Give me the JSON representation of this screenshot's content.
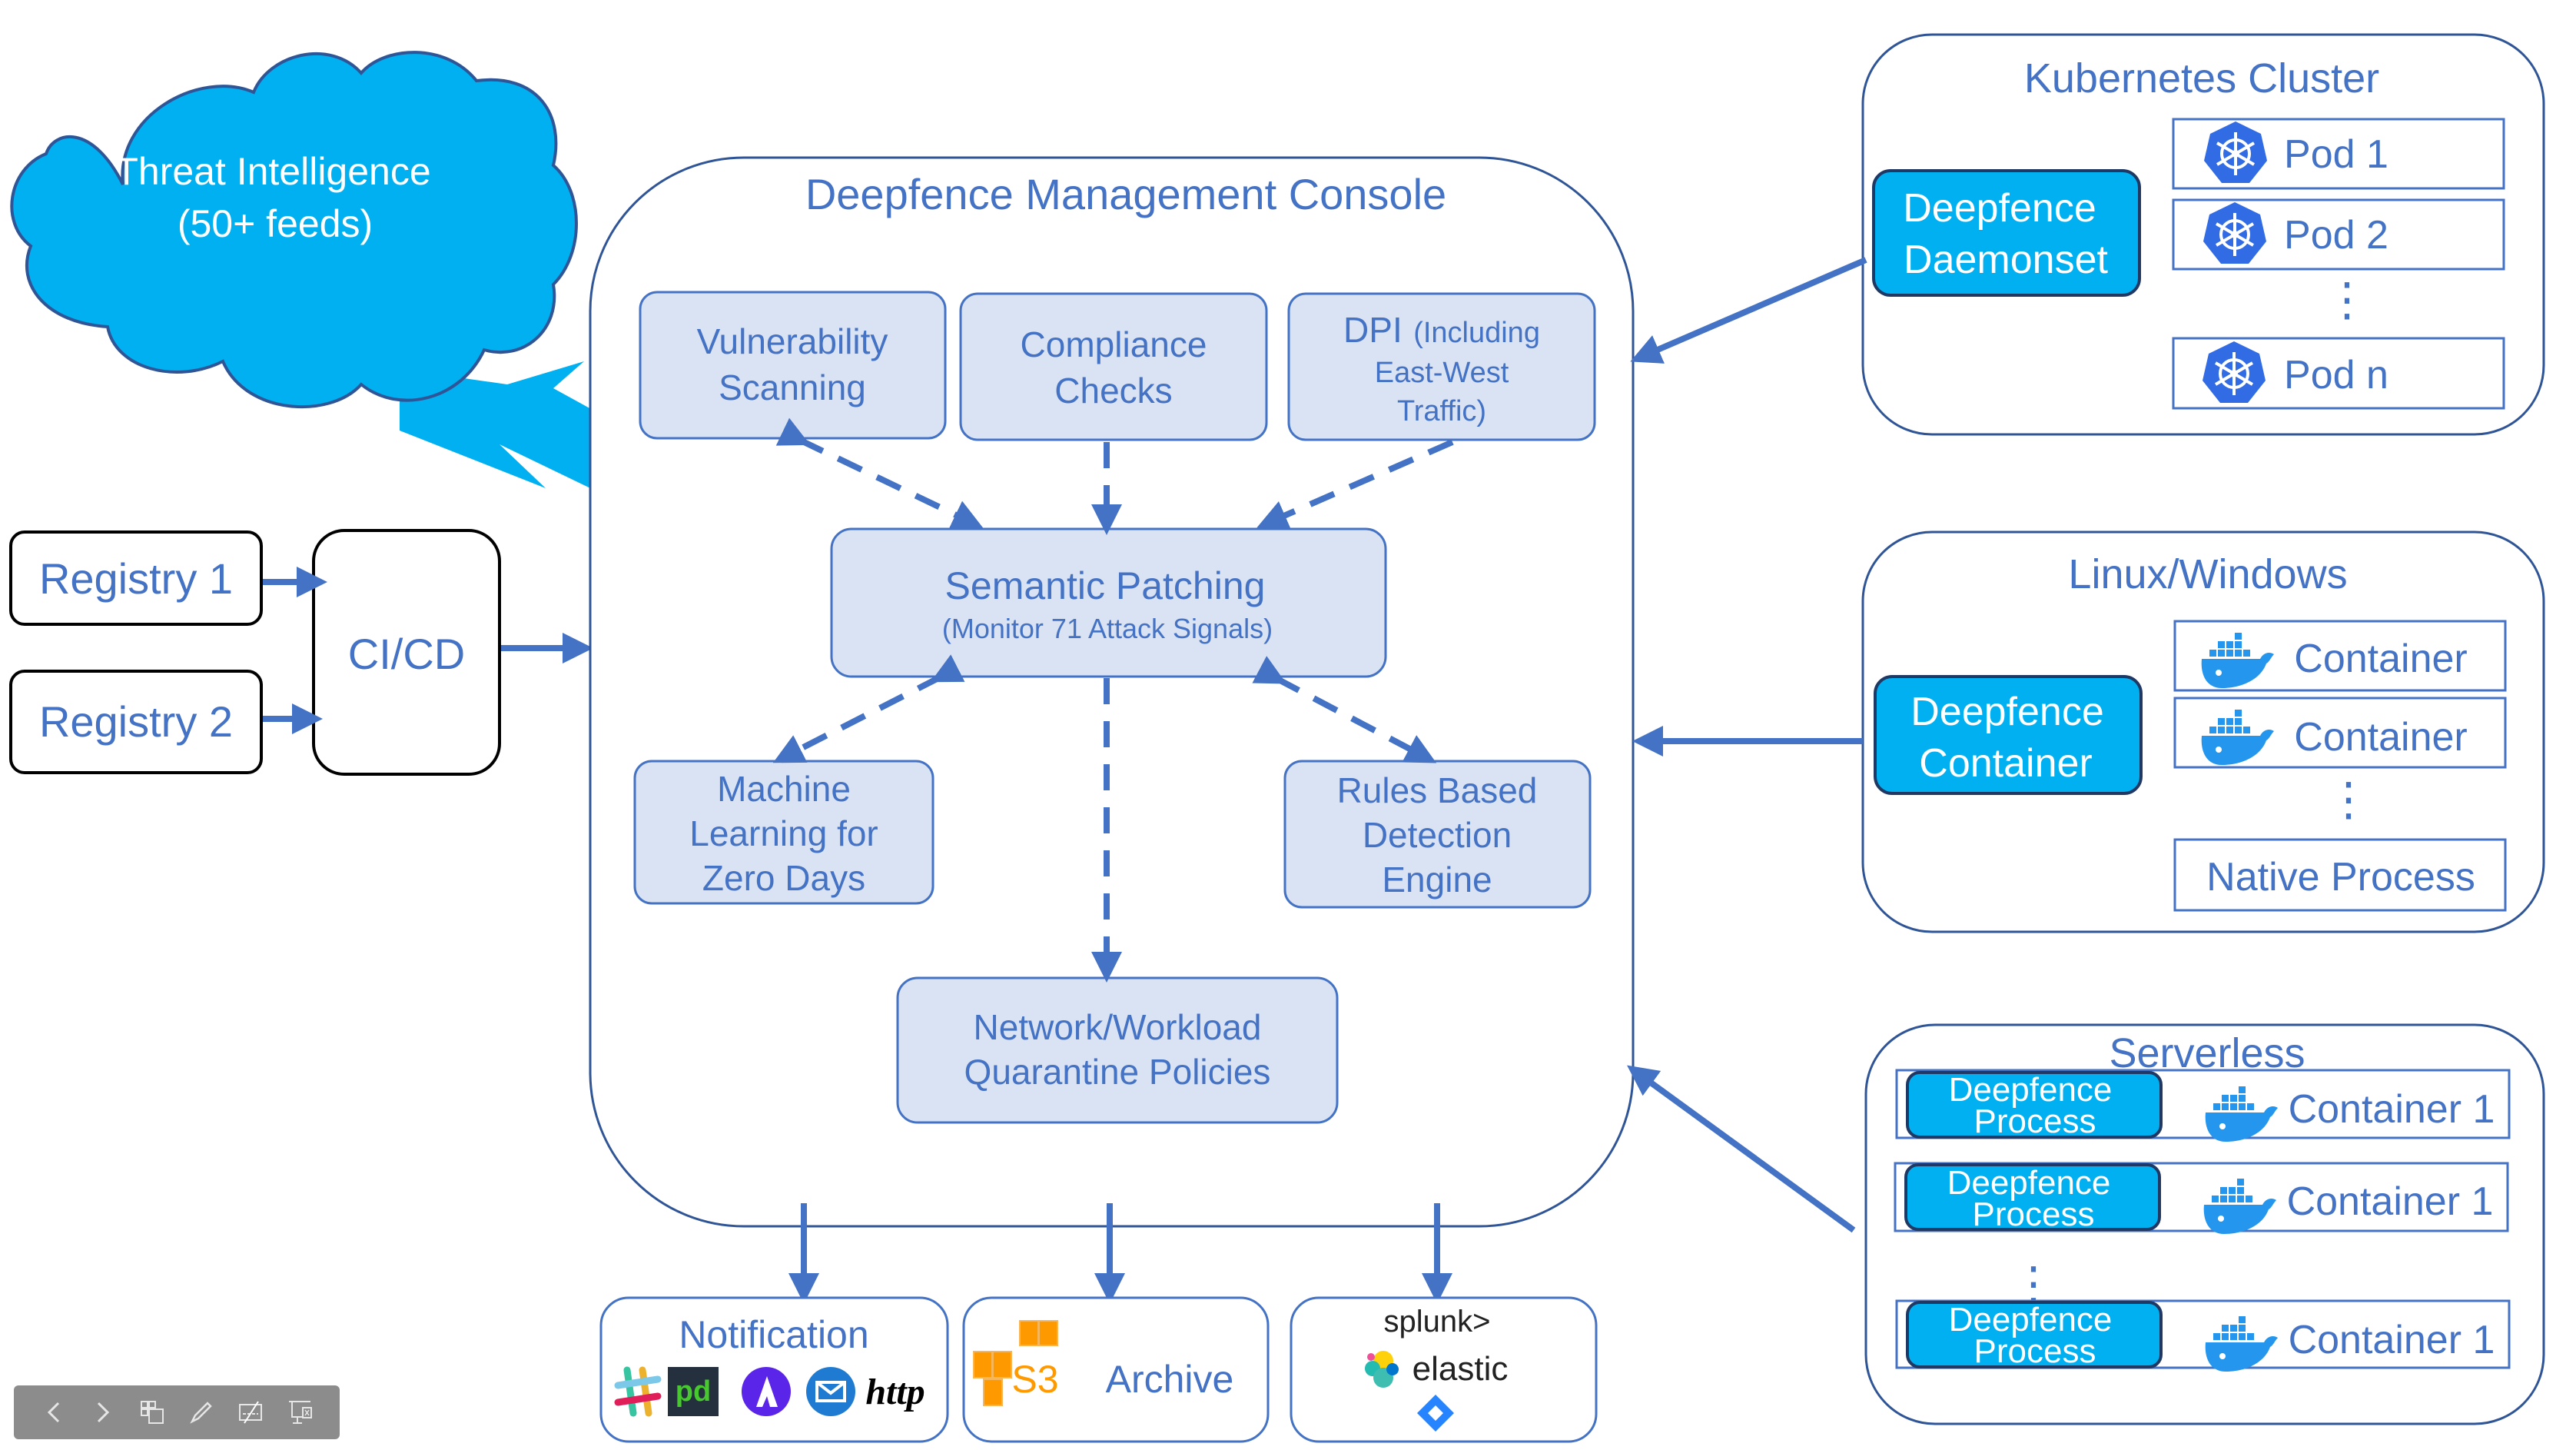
{
  "threat_intel": {
    "line1": "Threat Intelligence",
    "line2": "(50+ feeds)"
  },
  "sources": {
    "registry1": "Registry 1",
    "registry2": "Registry 2",
    "cicd": "CI/CD"
  },
  "console": {
    "title": "Deepfence Management Console",
    "vulnerability": [
      "Vulnerability",
      "Scanning"
    ],
    "compliance": [
      "Compliance",
      "Checks"
    ],
    "dpi": [
      "DPI",
      "(Including",
      "East-West",
      "Traffic)"
    ],
    "semantic": {
      "title": "Semantic Patching",
      "subtitle": "(Monitor 71 Attack Signals)"
    },
    "ml": [
      "Machine",
      "Learning for",
      "Zero Days"
    ],
    "rules": [
      "Rules Based",
      "Detection",
      "Engine"
    ],
    "quarantine": [
      "Network/Workload",
      "Quarantine Policies"
    ]
  },
  "outputs": {
    "notification": {
      "title": "Notification",
      "icons": [
        "slack-icon",
        "pagerduty-icon",
        "atlassian-icon",
        "email-icon",
        "http-icon"
      ],
      "http_label": "http",
      "pd_label": "pd"
    },
    "archive": {
      "s3_label": "S3",
      "title": "Archive"
    },
    "siem": {
      "splunk": "splunk>",
      "elastic": "elastic",
      "icons": [
        "splunk-logo",
        "elastic-logo",
        "jira-icon"
      ]
    }
  },
  "kubernetes": {
    "title": "Kubernetes Cluster",
    "agent": [
      "Deepfence",
      "Daemonset"
    ],
    "pods": [
      "Pod 1",
      "Pod 2",
      "Pod n"
    ],
    "ellipsis": "⋮"
  },
  "linux": {
    "title": "Linux/Windows",
    "agent": [
      "Deepfence",
      "Container"
    ],
    "containers": [
      "Container",
      "Container"
    ],
    "native": "Native Process",
    "ellipsis": "⋮"
  },
  "serverless": {
    "title": "Serverless",
    "rows": [
      {
        "agent": [
          "Deepfence",
          "Process"
        ],
        "container": "Container 1"
      },
      {
        "agent": [
          "Deepfence",
          "Process"
        ],
        "container": "Container 1"
      },
      {
        "agent": [
          "Deepfence",
          "Process"
        ],
        "container": "Container 1"
      }
    ],
    "ellipsis": "⋮"
  },
  "toolbar": {
    "buttons": [
      "previous-slide",
      "next-slide",
      "see-all-slides",
      "pen-tool",
      "subtitles-off",
      "end-show"
    ]
  },
  "colors": {
    "accent_blue": "#4472c4",
    "light_fill": "#dae3f3",
    "cyan_fill": "#00b0f0",
    "dark_outline": "#2f5597",
    "k8s_blue": "#326ce5",
    "docker_blue": "#2496ed",
    "aws_orange": "#f90"
  }
}
